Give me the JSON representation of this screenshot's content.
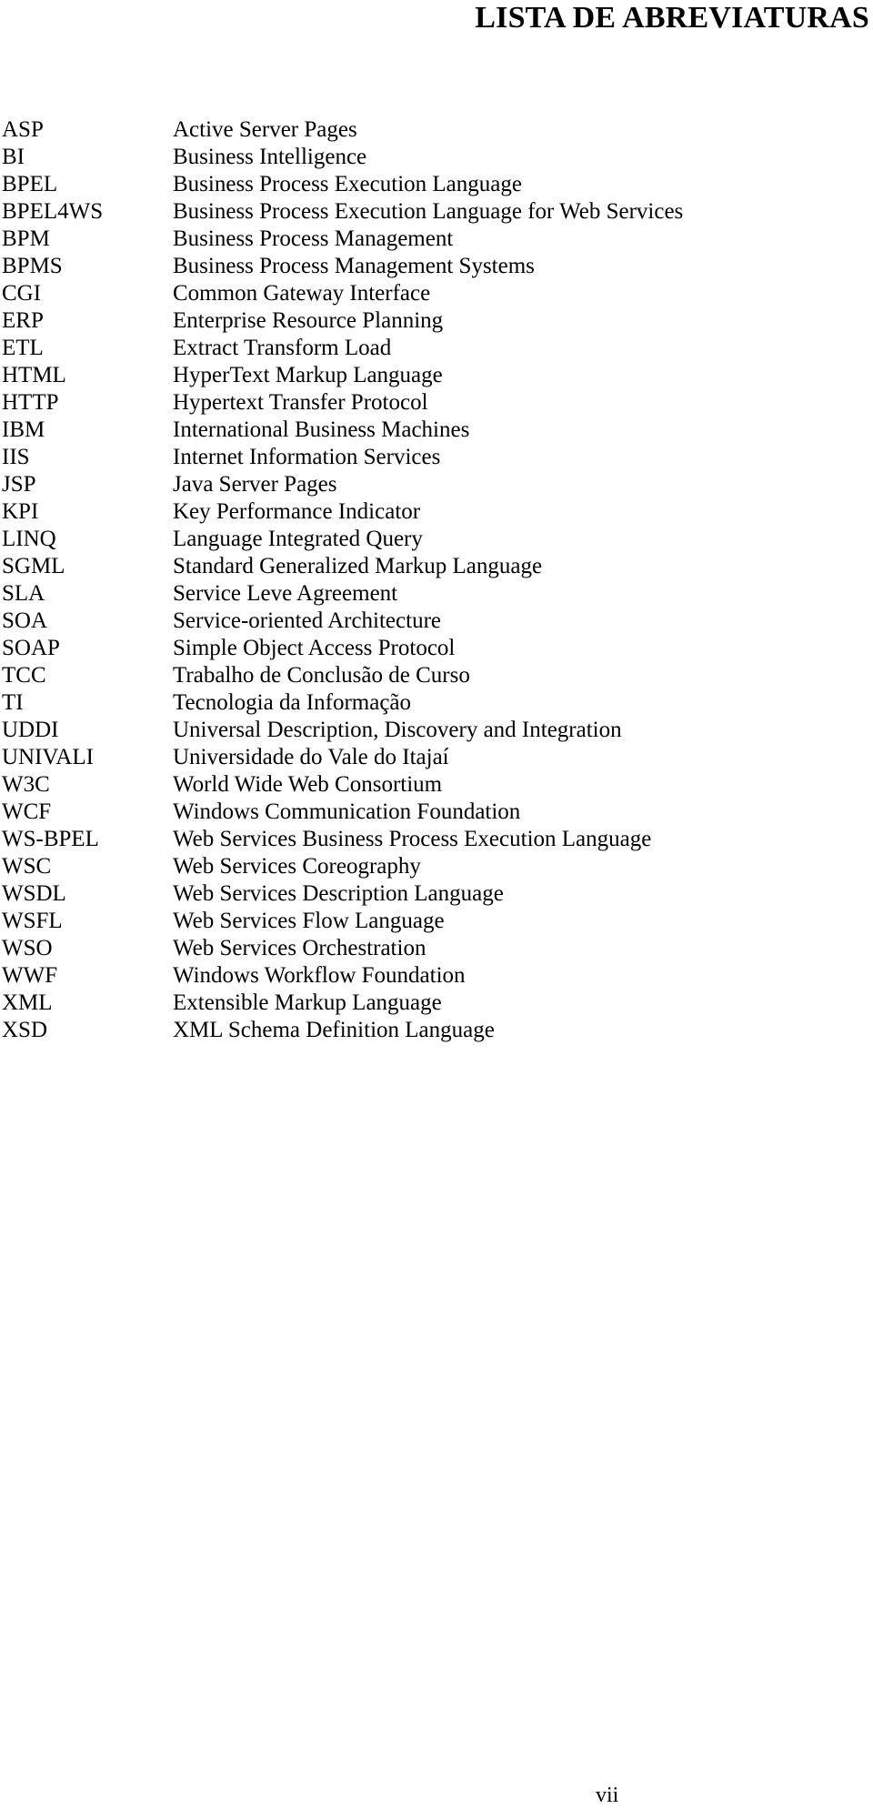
{
  "document": {
    "title": "LISTA DE ABREVIATURAS",
    "page_number": "vii",
    "text_color": "#000000",
    "background_color": "#ffffff"
  },
  "abbreviations": [
    {
      "term": "ASP",
      "definition": "Active Server Pages"
    },
    {
      "term": "BI",
      "definition": "Business Intelligence"
    },
    {
      "term": "BPEL",
      "definition": "Business Process Execution Language"
    },
    {
      "term": "BPEL4WS",
      "definition": "Business Process Execution Language for Web Services"
    },
    {
      "term": "BPM",
      "definition": "Business Process Management"
    },
    {
      "term": "BPMS",
      "definition": "Business Process Management Systems"
    },
    {
      "term": "CGI",
      "definition": "Common Gateway Interface"
    },
    {
      "term": "ERP",
      "definition": "Enterprise Resource Planning"
    },
    {
      "term": "ETL",
      "definition": "Extract Transform Load"
    },
    {
      "term": "HTML",
      "definition": "HyperText Markup Language"
    },
    {
      "term": "HTTP",
      "definition": "Hypertext Transfer Protocol"
    },
    {
      "term": "IBM",
      "definition": "International Business Machines"
    },
    {
      "term": "IIS",
      "definition": "Internet Information Services"
    },
    {
      "term": "JSP",
      "definition": "Java Server Pages"
    },
    {
      "term": "KPI",
      "definition": "Key Performance Indicator"
    },
    {
      "term": "LINQ",
      "definition": "Language Integrated Query"
    },
    {
      "term": "SGML",
      "definition": "Standard Generalized Markup Language"
    },
    {
      "term": "SLA",
      "definition": "Service Leve Agreement"
    },
    {
      "term": "SOA",
      "definition": "Service-oriented Architecture"
    },
    {
      "term": "SOAP",
      "definition": "Simple Object Access Protocol"
    },
    {
      "term": "TCC",
      "definition": "Trabalho de Conclusão de Curso"
    },
    {
      "term": "TI",
      "definition": "Tecnologia da Informação"
    },
    {
      "term": "UDDI",
      "definition": "Universal Description, Discovery and Integration"
    },
    {
      "term": "UNIVALI",
      "definition": "Universidade do Vale do Itajaí"
    },
    {
      "term": "W3C",
      "definition": "World Wide Web Consortium"
    },
    {
      "term": "WCF",
      "definition": "Windows Communication Foundation"
    },
    {
      "term": "WS-BPEL",
      "definition": "Web Services Business Process Execution Language"
    },
    {
      "term": "WSC",
      "definition": "Web Services Coreography"
    },
    {
      "term": "WSDL",
      "definition": "Web Services Description Language"
    },
    {
      "term": "WSFL",
      "definition": "Web Services Flow Language"
    },
    {
      "term": "WSO",
      "definition": "Web Services Orchestration"
    },
    {
      "term": "WWF",
      "definition": "Windows Workflow Foundation"
    },
    {
      "term": "XML",
      "definition": "Extensible Markup Language"
    },
    {
      "term": "XSD",
      "definition": "XML Schema Definition Language"
    }
  ]
}
